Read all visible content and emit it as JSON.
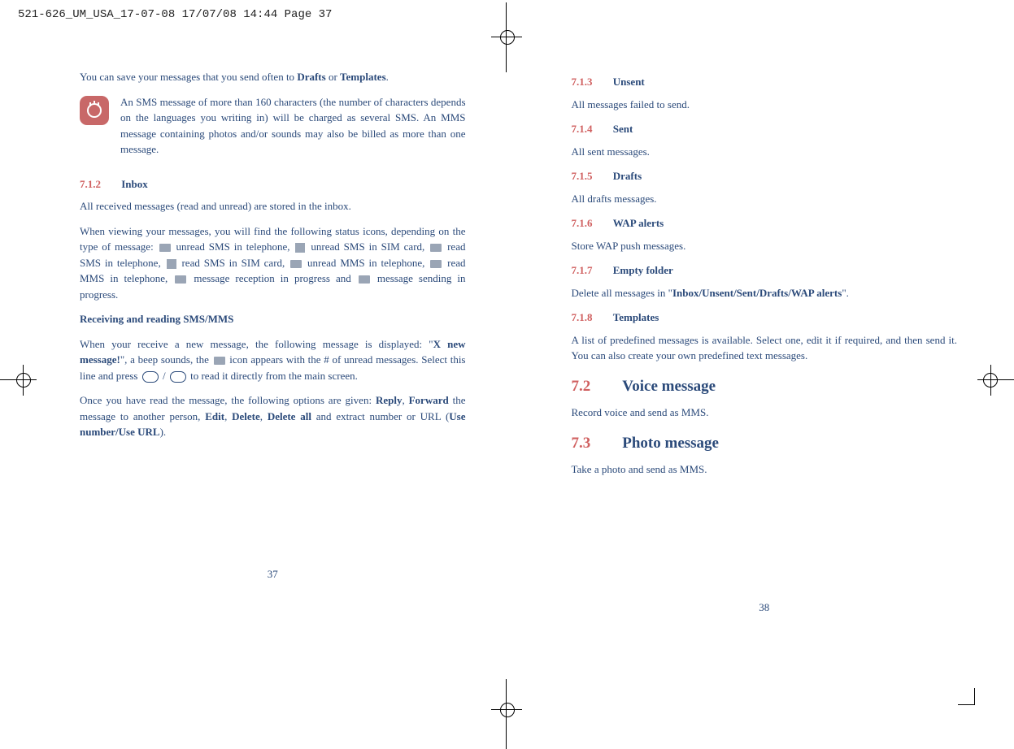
{
  "header": "521-626_UM_USA_17-07-08  17/07/08  14:44  Page 37",
  "left": {
    "intro_pre": "You can save your messages that you send often to ",
    "intro_b1": "Drafts",
    "intro_mid": " or ",
    "intro_b2": "Templates",
    "intro_end": ".",
    "note": "An SMS message of more than 160 characters (the number of characters depends on the languages you writing in) will be charged as several SMS. An MMS message containing photos and/or sounds may also be billed as more than one message.",
    "s712_num": "7.1.2",
    "s712_title": "Inbox",
    "inbox_p1": "All received messages (read and unread) are stored in the inbox.",
    "icons_pre": "When viewing your messages, you will find the following status icons, depending on the type of message: ",
    "ic1": " unread SMS in telephone, ",
    "ic2": " unread SMS in SIM card, ",
    "ic3": " read SMS in telephone, ",
    "ic4": " read SMS in SIM card, ",
    "ic5": " unread MMS in telephone, ",
    "ic6": " read MMS in telephone, ",
    "ic7": " message reception in progress and ",
    "ic8": " message sending in progress.",
    "sub1": "Receiving and reading SMS/MMS",
    "recv_pre": "When your receive a new message, the following message is displayed: \"",
    "recv_b1": "X new message!",
    "recv_mid1": "\", a beep sounds, the ",
    "recv_mid2": " icon appears with the # of unread messages. Select this line and press ",
    "recv_slash": " / ",
    "recv_end": " to read it directly from the main screen.",
    "opts_pre": "Once you have read the message, the following options are given: ",
    "opt1": "Reply",
    "opts_c1": ", ",
    "opt2": "Forward",
    "opts_mid": " the message to another person, ",
    "opt3": "Edit",
    "opts_c2": ", ",
    "opt4": "Delete",
    "opts_c3": ", ",
    "opt5": "Delete all",
    "opts_and": " and extract number or URL (",
    "opt6": "Use number/Use URL",
    "opts_end": ").",
    "pagenum": "37"
  },
  "right": {
    "s713_num": "7.1.3",
    "s713_title": "Unsent",
    "s713_body": "All messages failed to send.",
    "s714_num": "7.1.4",
    "s714_title": "Sent",
    "s714_body": "All sent messages.",
    "s715_num": "7.1.5",
    "s715_title": "Drafts",
    "s715_body": "All drafts messages.",
    "s716_num": "7.1.6",
    "s716_title": "WAP alerts",
    "s716_body": "Store WAP push messages.",
    "s717_num": "7.1.7",
    "s717_title": "Empty folder",
    "s717_pre": "Delete all messages in \"",
    "s717_b": "Inbox/Unsent/Sent/Drafts/WAP alerts",
    "s717_end": "\".",
    "s718_num": "7.1.8",
    "s718_title": "Templates",
    "s718_body": "A list of predefined messages is available. Select one, edit it if required, and then send it.  You can also create your own predefined text messages.",
    "s72_num": "7.2",
    "s72_title": "Voice message",
    "s72_body": "Record voice and send as MMS.",
    "s73_num": "7.3",
    "s73_title": "Photo message",
    "s73_body": "Take a photo and send as MMS.",
    "pagenum": "38"
  }
}
